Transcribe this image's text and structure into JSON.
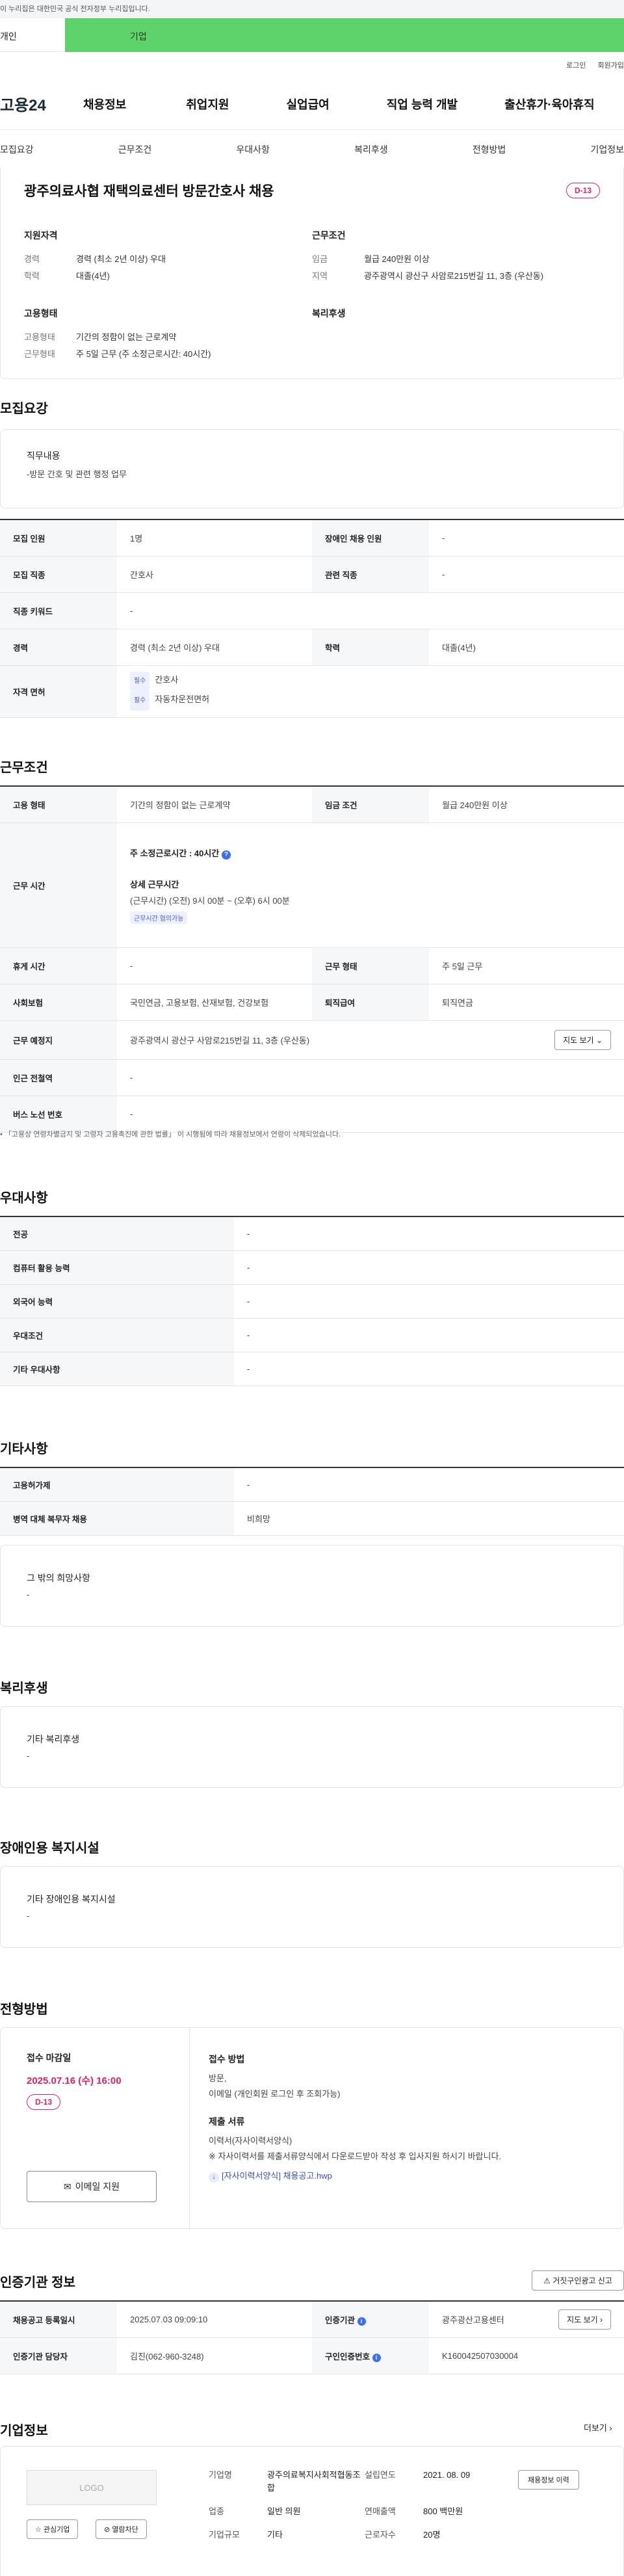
{
  "gov_banner": "이 누리집은 대한민국 공식 전자정부 누리집입니다.",
  "tabs": {
    "personal": "개인",
    "corporate": "기업"
  },
  "util": {
    "login": "로그인",
    "signup": "회원가입"
  },
  "logo": "고용24",
  "gnb": [
    "채용정보",
    "취업지원",
    "실업급여",
    "직업 능력 개발",
    "출산휴가·육아휴직"
  ],
  "subnav": [
    "모집요강",
    "근무조건",
    "우대사항",
    "복리후생",
    "전형방법",
    "기업정보"
  ],
  "summary": {
    "title": "광주의료사협 재택의료센터 방문간호사 채용",
    "dday": "D-13",
    "qual_title": "지원자격",
    "qual": [
      {
        "k": "경력",
        "v": "경력 (최소 2년 이상) 우대"
      },
      {
        "k": "학력",
        "v": "대졸(4년)"
      }
    ],
    "cond_title": "근무조건",
    "cond": [
      {
        "k": "임금",
        "v": "월급 240만원 이상"
      },
      {
        "k": "지역",
        "v": "광주광역시 광산구 사암로215번길 11, 3층 (우산동)"
      }
    ],
    "emp_title": "고용형태",
    "emp": [
      {
        "k": "고용형태",
        "v": "기간의 정함이 없는 근로계약"
      },
      {
        "k": "근무형태",
        "v": "주 5일 근무 (주 소정근로시간: 40시간)"
      }
    ],
    "welfare_title": "복리후생"
  },
  "recruit": {
    "title": "모집요강",
    "duty_label": "직무내용",
    "duty_value": "-방문 간호 및 관련 행정 업무",
    "rows": [
      {
        "k1": "모집 인원",
        "v1": "1명",
        "k2": "장애인 채용 인원",
        "v2": "-"
      },
      {
        "k1": "모집 직종",
        "v1": "간호사",
        "k2": "관련 직종",
        "v2": "-"
      },
      {
        "k1": "직종 키워드",
        "v1": "-"
      },
      {
        "k1": "경력",
        "v1": "경력 (최소 2년 이상) 우대",
        "k2": "학력",
        "v2": "대졸(4년)"
      }
    ],
    "license_label": "자격 면허",
    "licenses": [
      {
        "tag": "필수",
        "name": "간호사"
      },
      {
        "tag": "필수",
        "name": "자동차운전면허"
      }
    ]
  },
  "work": {
    "title": "근무조건",
    "emp_type_label": "고용 형태",
    "emp_type": "기간의 정함이 없는 근로계약",
    "wage_label": "임금 조건",
    "wage": "월급 240만원 이상",
    "hours_label": "근무 시간",
    "weekly_hours": "주 소정근로시간 : 40시간",
    "detail_title": "상세 근무시간",
    "detail": "(근무시간) (오전) 9시 00분 ~ (오후) 6시 00분",
    "detail_tag": "근무시간 협의가능",
    "break_label": "휴게 시간",
    "break": "-",
    "form_label": "근무 형태",
    "form": "주 5일 근무",
    "insurance_label": "사회보험",
    "insurance": "국민연금, 고용보험, 산재보험, 건강보험",
    "retire_label": "퇴직급여",
    "retire": "퇴직연금",
    "place_label": "근무 예정지",
    "place": "광주광역시 광산구 사암로215번길 11, 3층 (우산동)",
    "map_btn": "지도 보기",
    "station_label": "인근 전철역",
    "station": "-",
    "bus_label": "버스 노선 번호",
    "bus": "-",
    "note": "「고용상 연령차별금지 및 고령자 고용촉진에 관한 법률」 이 시행됨에 따라 채용정보에서 연령이 삭제되었습니다."
  },
  "prefer": {
    "title": "우대사항",
    "rows": [
      {
        "k": "전공",
        "v": "-"
      },
      {
        "k": "컴퓨터 활용 능력",
        "v": "-"
      },
      {
        "k": "외국어 능력",
        "v": "-"
      },
      {
        "k": "우대조건",
        "v": "-"
      },
      {
        "k": "기타 우대사항",
        "v": "-"
      }
    ]
  },
  "etc": {
    "title": "기타사항",
    "rows": [
      {
        "k": "고용허가제",
        "v": "-"
      },
      {
        "k": "병역 대체 복무자 채용",
        "v": "비희망"
      }
    ],
    "other_label": "그 밖의 희망사항",
    "other_value": "-"
  },
  "welfare": {
    "title": "복리후생",
    "label": "기타 복리후생",
    "value": "-"
  },
  "disabled": {
    "title": "장애인용 복지시설",
    "label": "기타 장애인용 복지시설",
    "value": "-"
  },
  "process": {
    "title": "전형방법",
    "deadline_label": "접수 마감일",
    "deadline": "2025.07.16 (수) 16:00",
    "dday": "D-13",
    "email_btn": "이메일 지원",
    "method_label": "접수 방법",
    "method": "방문,",
    "method2": "이메일 (개인회원 로그인 후 조회가능)",
    "docs_label": "제출 서류",
    "docs1": "이력서(자사이력서양식)",
    "docs2": "※ 자사이력서를 제출서류양식에서 다운로드받아 작성 후 입사지원 하시기 바랍니다.",
    "attach": "[자사이력서양식] 채용공고.hwp"
  },
  "agency": {
    "title": "인증기관 정보",
    "report_btn": "거짓구인광고 신고",
    "reg_label": "채용공고 등록일시",
    "reg": "2025.07.03 09:09:10",
    "org_label": "인증기관",
    "org": "광주광산고용센터",
    "map_btn": "지도 보기",
    "mgr_label": "인증기관 담당자",
    "mgr": "김진(062-960-3248)",
    "cert_label": "구인인증번호",
    "cert": "K160042507030004"
  },
  "company": {
    "title": "기업정보",
    "more": "더보기",
    "logo": "LOGO",
    "fav_btn": "관심기업",
    "block_btn": "열람차단",
    "info_btn": "채용정보 이력",
    "name_label": "기업명",
    "name": "광주의료복지사회적협동조합",
    "founded_label": "설립연도",
    "founded": "2021. 08. 09",
    "industry_label": "업종",
    "industry": "일반 의원",
    "sales_label": "연매출액",
    "sales": "800 백만원",
    "size_label": "기업규모",
    "size": "기타",
    "emp_label": "근로자수",
    "emp": "20명"
  }
}
